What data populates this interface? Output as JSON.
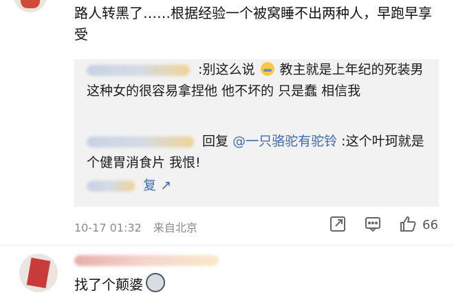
{
  "main_comment": {
    "text": "路人转黑了……根据经验一个被窝睡不出两种人，早跑早享受"
  },
  "replies": [
    {
      "text_before": ":别这么说",
      "text_after": "教主就是上年纪的死装男  这种女的很容易拿捏他  他不坏的 只是蠢 相信我",
      "emoji": "crying-laughing-emoji"
    },
    {
      "reply_word": "回复",
      "mention": "@一只骆驼有驼铃",
      "text": ":这个叶珂就是个健胃消食片 我恨!"
    },
    {
      "text": "复 ↗"
    }
  ],
  "meta": {
    "date": "10-17 01:32",
    "location": "来自北京",
    "like_count": "66"
  },
  "second_comment": {
    "text": "找了个颠婆",
    "emoji": "dog-emoji"
  },
  "colors": {
    "link": "#3d6bb3",
    "meta": "#8a8a8a",
    "reply_bg": "#f2f2f2"
  }
}
